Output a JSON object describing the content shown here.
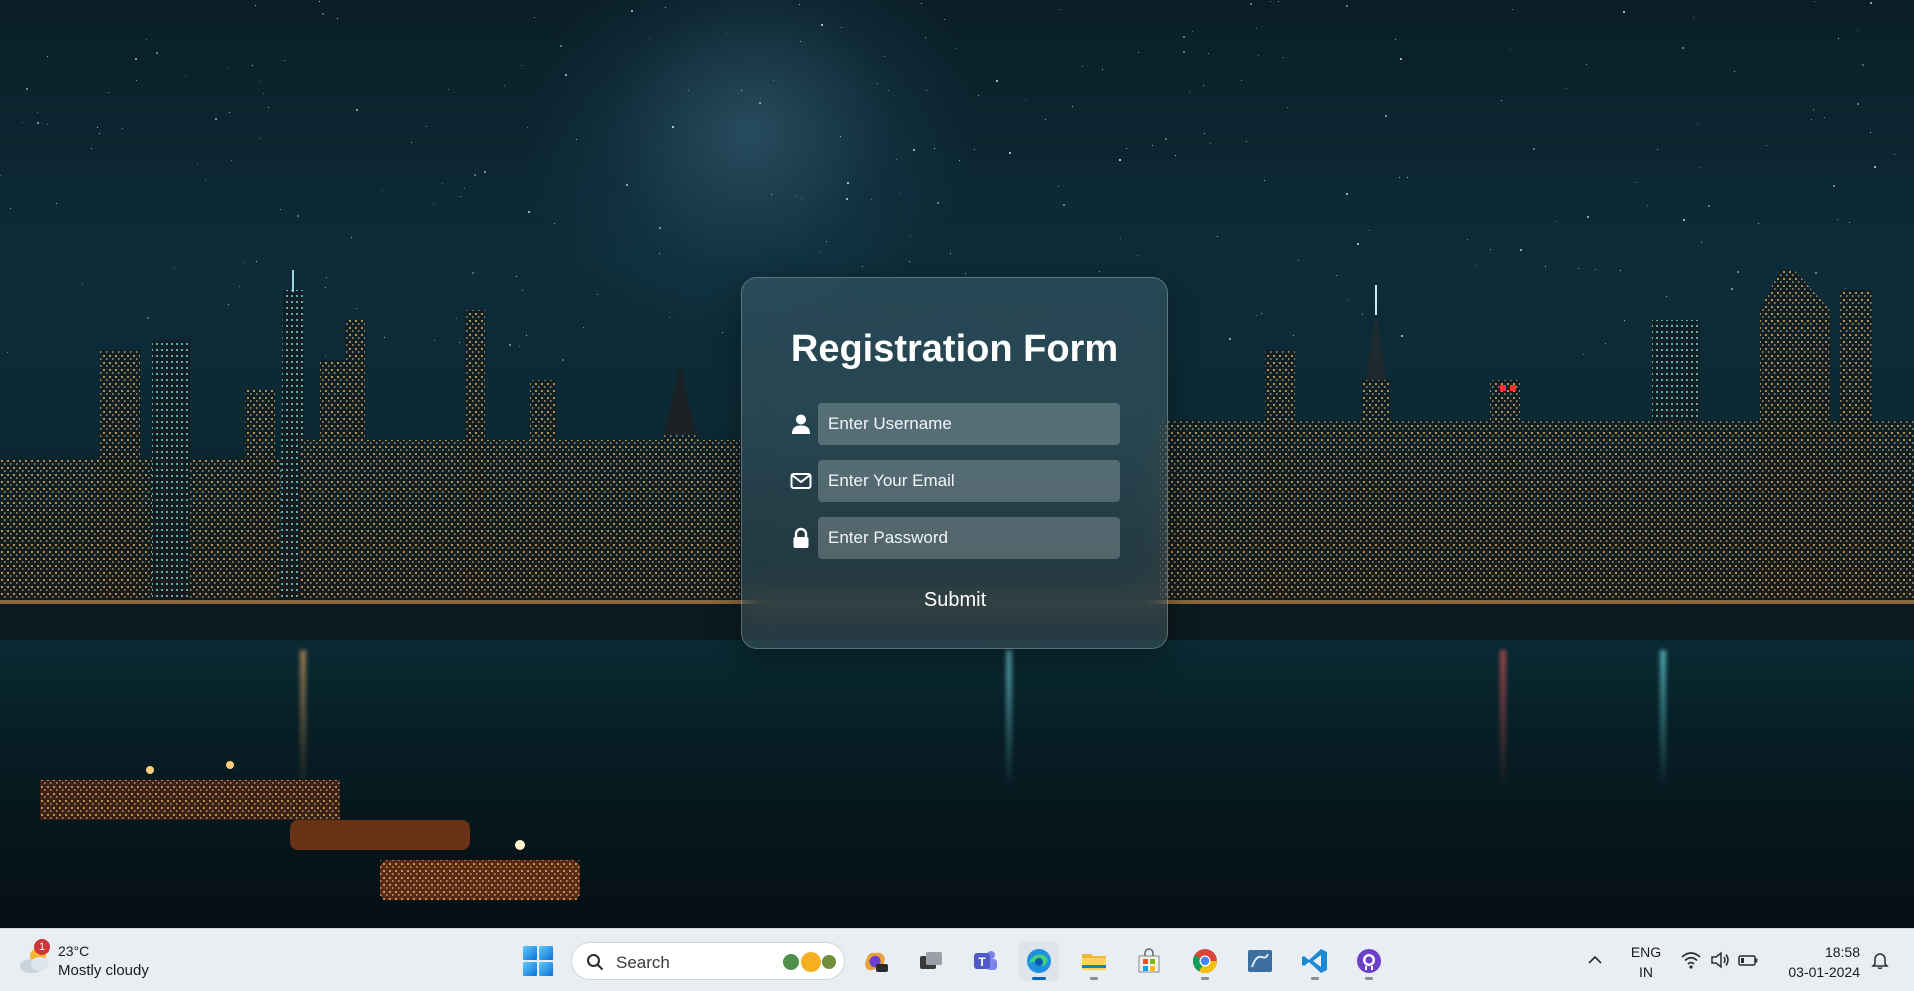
{
  "form": {
    "title": "Registration Form",
    "username_placeholder": "Enter Username",
    "email_placeholder": "Enter Your Email",
    "password_placeholder": "Enter Password",
    "submit_label": "Submit",
    "icons": [
      "user-icon",
      "envelope-icon",
      "lock-icon"
    ]
  },
  "taskbar": {
    "weather": {
      "temp": "23°C",
      "desc": "Mostly cloudy",
      "badge": "1"
    },
    "search_label": "Search",
    "apps": [
      "windows-start",
      "copilot",
      "task-view",
      "teams",
      "edge",
      "file-explorer",
      "microsoft-store",
      "chrome",
      "mysql-workbench",
      "vscode",
      "github-desktop"
    ],
    "language": {
      "line1": "ENG",
      "line2": "IN"
    },
    "clock": {
      "time": "18:58",
      "date": "03-01-2024"
    }
  },
  "colors": {
    "accent": "#0067c0",
    "card_glass": "rgba(160,200,215,0.18)"
  }
}
